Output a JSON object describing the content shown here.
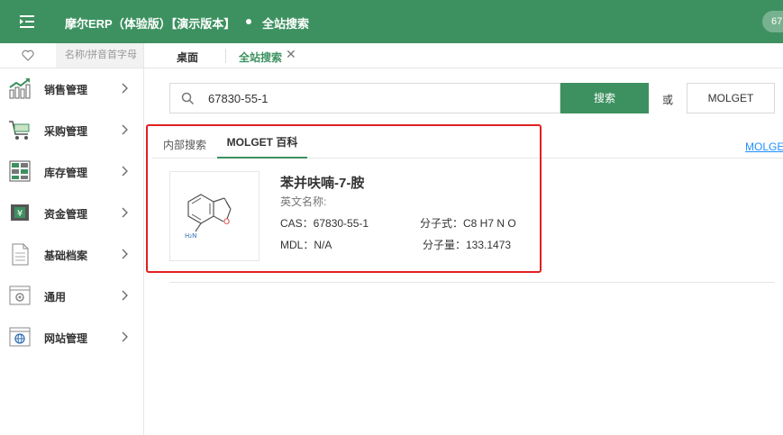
{
  "header": {
    "app_title": "摩尔ERP（体验版）【演示版本】",
    "current_page": "全站搜索",
    "user_badge": "67"
  },
  "sidebar": {
    "search_placeholder": "名称/拼音首字母",
    "items": [
      {
        "label": "销售管理",
        "icon": "sales-chart-icon"
      },
      {
        "label": "采购管理",
        "icon": "shopping-cart-icon"
      },
      {
        "label": "库存管理",
        "icon": "inventory-icon"
      },
      {
        "label": "资金管理",
        "icon": "money-icon"
      },
      {
        "label": "基础档案",
        "icon": "document-icon"
      },
      {
        "label": "通用",
        "icon": "settings-window-icon"
      },
      {
        "label": "网站管理",
        "icon": "globe-window-icon"
      }
    ]
  },
  "tabs": {
    "desktop": "桌面",
    "active": "全站搜索",
    "close": "✕"
  },
  "search": {
    "value": "67830-55-1",
    "button": "搜索",
    "or": "或",
    "molget_button": "MOLGET"
  },
  "result_tabs": {
    "internal": "内部搜索",
    "molget": "MOLGET 百科",
    "link": "MOLGET"
  },
  "result": {
    "name": "苯并呋喃-7-胺",
    "english_name": "英文名称:",
    "cas": "CAS：67830-55-1",
    "formula": "分子式：C8 H7 N O",
    "mdl": "MDL：N/A",
    "mw": "分子量：133.1473",
    "atom_n": "H₂N",
    "atom_o": "O"
  },
  "colors": {
    "brand": "#3d9160",
    "highlight": "#e02020",
    "link": "#1e90ff"
  }
}
